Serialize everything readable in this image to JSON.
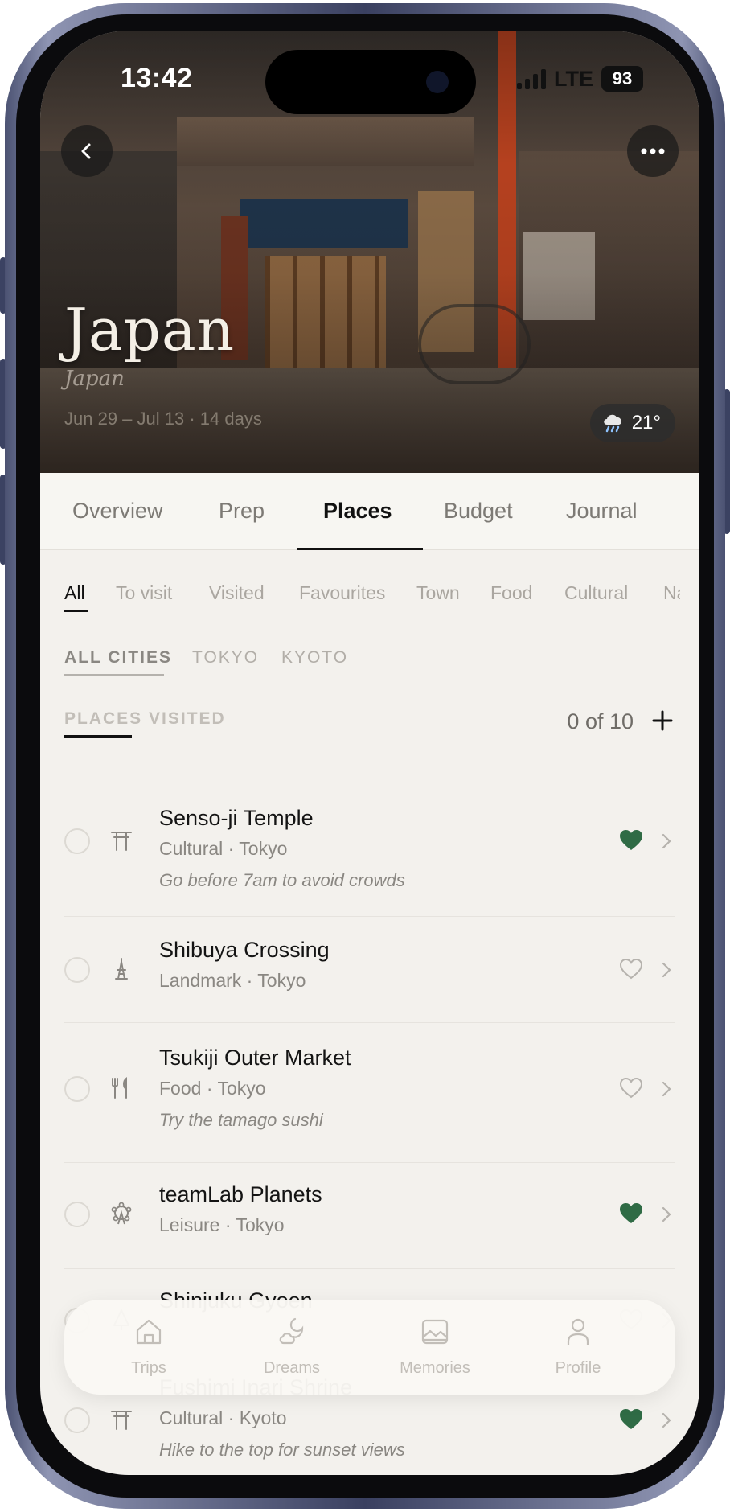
{
  "status_bar": {
    "time": "13:42",
    "network": "LTE",
    "battery": "93"
  },
  "hero": {
    "title": "Japan",
    "subtitle": "Japan",
    "dates": "Jun 29 – Jul 13 · 14 days",
    "weather": {
      "icon": "rain-cloud-icon",
      "temp": "21°"
    }
  },
  "tabs": [
    {
      "label": "Overview"
    },
    {
      "label": "Prep"
    },
    {
      "label": "Places"
    },
    {
      "label": "Budget"
    },
    {
      "label": "Journal"
    }
  ],
  "active_tab": "Places",
  "filters": [
    "All",
    "To visit",
    "Visited",
    "Favourites",
    "Town",
    "Food",
    "Cultural",
    "Na"
  ],
  "active_filter": "All",
  "cities": [
    "ALL CITIES",
    "TOKYO",
    "KYOTO"
  ],
  "active_city": "ALL CITIES",
  "places_visited": {
    "label": "PLACES VISITED",
    "count": "0 of 10"
  },
  "places": [
    {
      "name": "Senso-ji Temple",
      "meta": "Cultural · Tokyo",
      "note": "Go before 7am to avoid crowds",
      "icon": "torii-icon",
      "favourite": true
    },
    {
      "name": "Shibuya Crossing",
      "meta": "Landmark · Tokyo",
      "note": "",
      "icon": "tower-icon",
      "favourite": false
    },
    {
      "name": "Tsukiji Outer Market",
      "meta": "Food · Tokyo",
      "note": "Try the tamago sushi",
      "icon": "fork-knife-icon",
      "favourite": false
    },
    {
      "name": "teamLab Planets",
      "meta": "Leisure · Tokyo",
      "note": "",
      "icon": "ferris-wheel-icon",
      "favourite": true
    },
    {
      "name": "Shinjuku Gyoen",
      "meta": "",
      "note": "",
      "icon": "tree-icon",
      "favourite": false
    },
    {
      "name": "Fushimi Inari Shrine",
      "meta": "Cultural · Kyoto",
      "note": "Hike to the top for sunset views",
      "icon": "torii-icon",
      "favourite": true
    }
  ],
  "bottom_nav": [
    {
      "label": "Trips",
      "icon": "home-icon"
    },
    {
      "label": "Dreams",
      "icon": "moon-cloud-icon"
    },
    {
      "label": "Memories",
      "icon": "photo-icon"
    },
    {
      "label": "Profile",
      "icon": "person-icon"
    }
  ],
  "colors": {
    "accent": "#2f6b45",
    "background": "#f3f1ed",
    "text": "#141414",
    "muted": "#8a8782"
  }
}
